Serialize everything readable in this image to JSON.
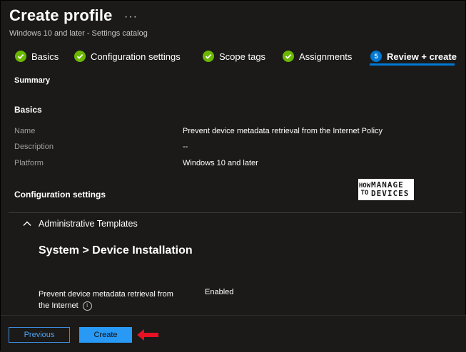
{
  "header": {
    "title": "Create profile",
    "more": "···",
    "subtitle": "Windows 10 and later - Settings catalog"
  },
  "tabs": [
    {
      "label": "Basics",
      "status": "complete"
    },
    {
      "label": "Configuration settings",
      "status": "complete"
    },
    {
      "label": "Scope tags",
      "status": "complete"
    },
    {
      "label": "Assignments",
      "status": "complete"
    },
    {
      "label": "Review + create",
      "status": "active",
      "step": "5"
    }
  ],
  "summary": {
    "title": "Summary",
    "basics_title": "Basics",
    "rows": [
      {
        "label": "Name",
        "value": "Prevent device metadata retrieval from the Internet Policy"
      },
      {
        "label": "Description",
        "value": "--"
      },
      {
        "label": "Platform",
        "value": "Windows 10 and later"
      }
    ],
    "config_title": "Configuration settings"
  },
  "logo": {
    "how": "HOW TO",
    "manage": "MANAGE",
    "devices": "DEVICES"
  },
  "config": {
    "group": "Administrative Templates",
    "path": "System > Device Installation",
    "setting_label_line1": "Prevent device metadata retrieval from",
    "setting_label_line2": "the Internet",
    "setting_value": "Enabled",
    "info_glyph": "i"
  },
  "footer": {
    "previous_label": "Previous",
    "create_label": "Create"
  },
  "colors": {
    "accent": "#0078d4",
    "check": "#6bb700",
    "arrow": "#e81123"
  }
}
